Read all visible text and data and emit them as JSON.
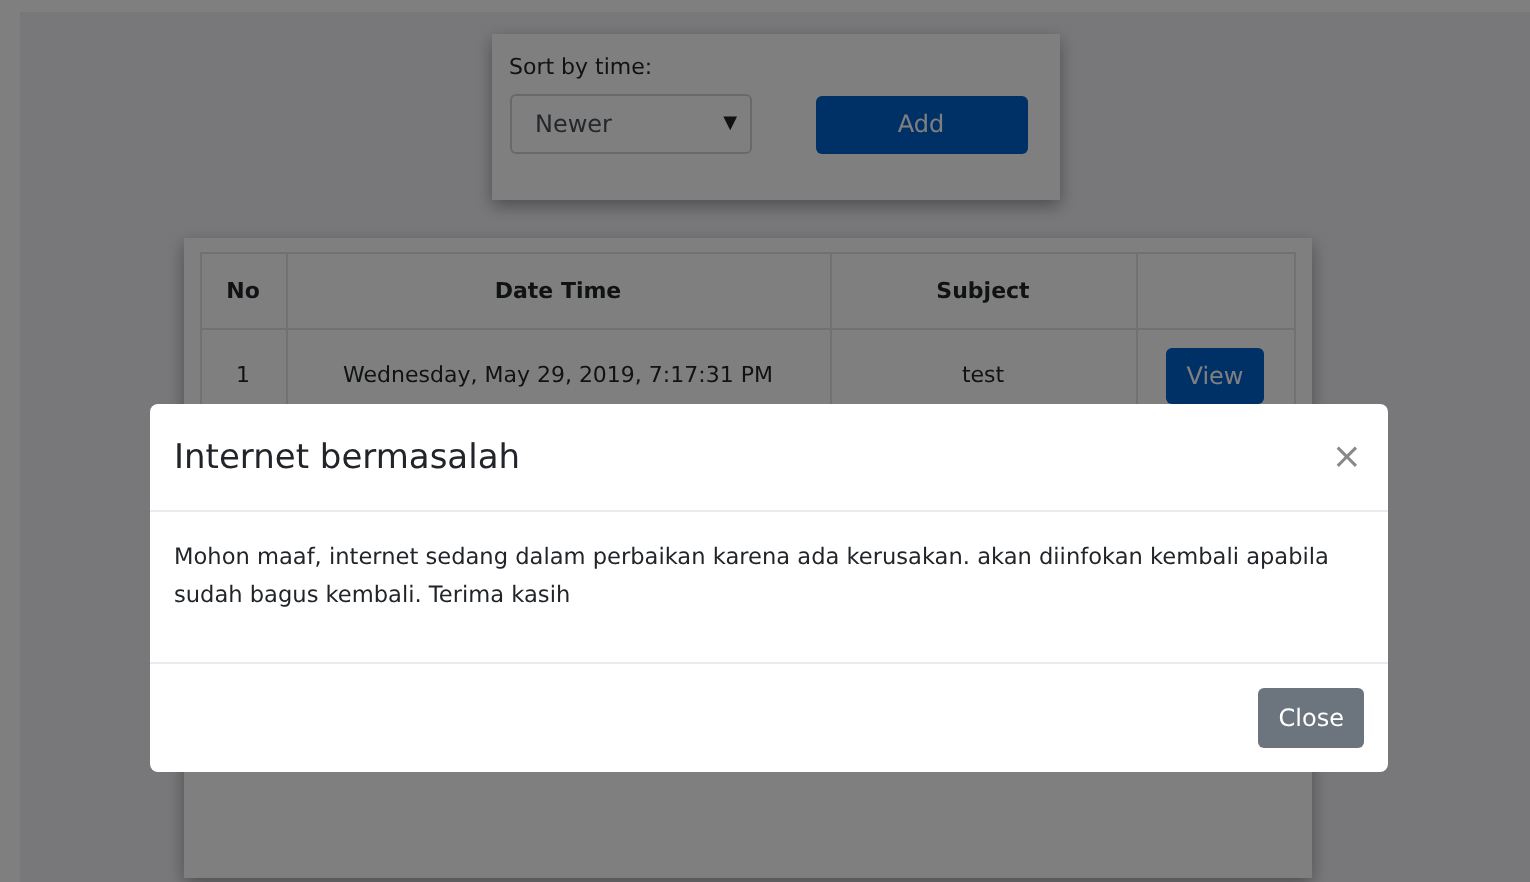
{
  "sort_panel": {
    "label": "Sort by time:",
    "sort_select": {
      "value": "Newer",
      "arrow": "▼"
    },
    "add_button": "Add"
  },
  "table": {
    "columns": [
      "No",
      "Date Time",
      "Subject",
      ""
    ],
    "rows": [
      {
        "no": "1",
        "date_time": "Wednesday, May 29, 2019, 7:17:31 PM",
        "subject": "test",
        "action": "View"
      }
    ]
  },
  "modal": {
    "open": true,
    "title": "Internet bermasalah",
    "close_icon": "×",
    "body": "Mohon maaf, internet sedang dalam perbaikan karena ada kerusakan. akan diinfokan kembali apabila sudah bagus kembali. Terima kasih",
    "close_button": "Close"
  }
}
